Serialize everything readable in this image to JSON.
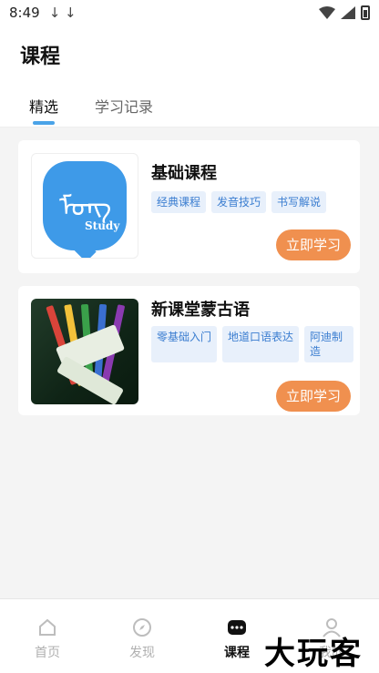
{
  "status_bar": {
    "time": "8:49",
    "download_glyphs": "↓ ↓"
  },
  "header": {
    "title": "课程"
  },
  "tabs": [
    {
      "label": "精选"
    },
    {
      "label": "学习记录"
    }
  ],
  "courses": [
    {
      "title": "基础课程",
      "thumb_text": "ᠮᠣᠩ",
      "thumb_study": "Study",
      "tags": [
        "经典课程",
        "发音技巧",
        "书写解说"
      ],
      "button": "立即学习"
    },
    {
      "title": "新课堂蒙古语",
      "tags": [
        "零基础入门",
        "地道口语表达",
        "阿迪制造"
      ],
      "button": "立即学习"
    }
  ],
  "bottom_nav": [
    {
      "label": "首页",
      "icon": "home-icon"
    },
    {
      "label": "发现",
      "icon": "compass-icon"
    },
    {
      "label": "课程",
      "icon": "course-icon",
      "active": true
    },
    {
      "label": "我的",
      "icon": "user-icon"
    }
  ],
  "watermark": "大玩客",
  "colors": {
    "accent": "#4aa3e8",
    "button": "#f0904f",
    "tag_bg": "#e8f0fb",
    "tag_text": "#3a7dd0"
  }
}
